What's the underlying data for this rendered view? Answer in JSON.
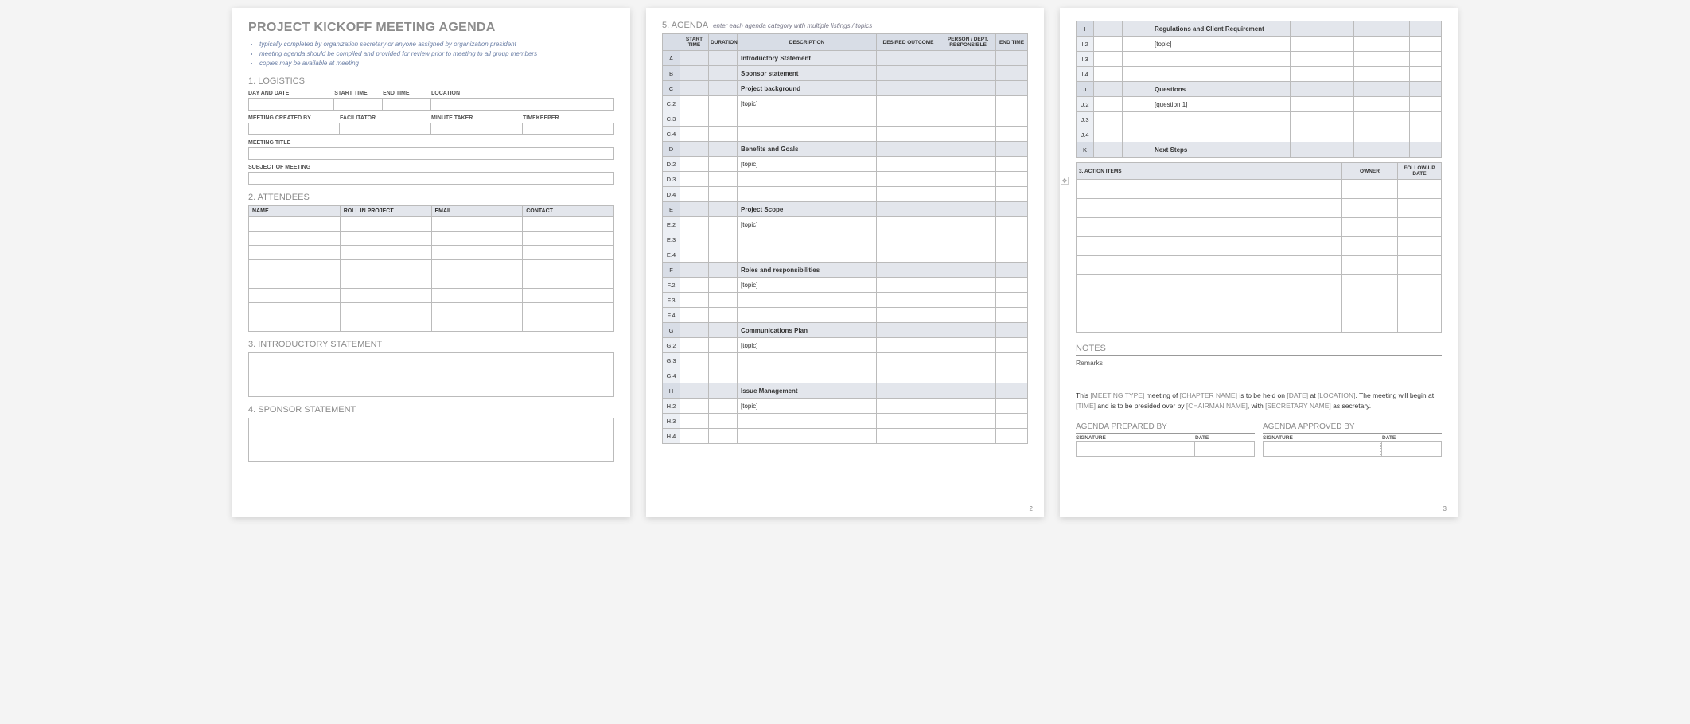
{
  "page1": {
    "title": "PROJECT KICKOFF MEETING AGENDA",
    "bullet1": "typically completed by organization secretary or anyone assigned by organization president",
    "bullet2": "meeting agenda should be compiled and provided for review prior to meeting to all group members",
    "bullet3": "copies may be available at meeting",
    "s1": "1. LOGISTICS",
    "f_day": "DAY AND DATE",
    "f_start": "START TIME",
    "f_end": "END TIME",
    "f_loc": "LOCATION",
    "f_created": "MEETING CREATED BY",
    "f_fac": "FACILITATOR",
    "f_min": "MINUTE TAKER",
    "f_time": "TIMEKEEPER",
    "f_title": "MEETING TITLE",
    "f_subj": "SUBJECT OF MEETING",
    "s2": "2. ATTENDEES",
    "att_h1": "NAME",
    "att_h2": "ROLL IN PROJECT",
    "att_h3": "EMAIL",
    "att_h4": "CONTACT",
    "s3": "3. INTRODUCTORY STATEMENT",
    "s4": "4. SPONSOR STATEMENT"
  },
  "page2": {
    "s5": "5. AGENDA",
    "note": "enter each agenda category with multiple listings / topics",
    "h1": "START TIME",
    "h2": "DURATION",
    "h3": "DESCRIPTION",
    "h4": "DESIRED OUTCOME",
    "h5": "PERSON / DEPT. RESPONSIBLE",
    "h6": "END TIME",
    "rows": [
      {
        "i": "A",
        "shade": true,
        "d": "Introductory Statement",
        "b": true
      },
      {
        "i": "B",
        "shade": true,
        "d": "Sponsor statement",
        "b": true
      },
      {
        "i": "C",
        "shade": true,
        "d": "Project background",
        "b": true
      },
      {
        "i": "C.2",
        "shade": false,
        "d": "[topic]"
      },
      {
        "i": "C.3",
        "shade": false,
        "d": ""
      },
      {
        "i": "C.4",
        "shade": false,
        "d": ""
      },
      {
        "i": "D",
        "shade": true,
        "d": "Benefits and Goals",
        "b": true
      },
      {
        "i": "D.2",
        "shade": false,
        "d": "[topic]"
      },
      {
        "i": "D.3",
        "shade": false,
        "d": ""
      },
      {
        "i": "D.4",
        "shade": false,
        "d": ""
      },
      {
        "i": "E",
        "shade": true,
        "d": "Project Scope",
        "b": true
      },
      {
        "i": "E.2",
        "shade": false,
        "d": "[topic]"
      },
      {
        "i": "E.3",
        "shade": false,
        "d": ""
      },
      {
        "i": "E.4",
        "shade": false,
        "d": ""
      },
      {
        "i": "F",
        "shade": true,
        "d": "Roles and responsibilities",
        "b": true
      },
      {
        "i": "F.2",
        "shade": false,
        "d": "[topic]"
      },
      {
        "i": "F.3",
        "shade": false,
        "d": ""
      },
      {
        "i": "F.4",
        "shade": false,
        "d": ""
      },
      {
        "i": "G",
        "shade": true,
        "d": "Communications Plan",
        "b": true
      },
      {
        "i": "G.2",
        "shade": false,
        "d": "[topic]"
      },
      {
        "i": "G.3",
        "shade": false,
        "d": ""
      },
      {
        "i": "G.4",
        "shade": false,
        "d": ""
      },
      {
        "i": "H",
        "shade": true,
        "d": "Issue Management",
        "b": true
      },
      {
        "i": "H.2",
        "shade": false,
        "d": "[topic]"
      },
      {
        "i": "H.3",
        "shade": false,
        "d": ""
      },
      {
        "i": "H.4",
        "shade": false,
        "d": ""
      }
    ],
    "pnum": "2"
  },
  "page3": {
    "rows": [
      {
        "i": "I",
        "shade": true,
        "d": "Regulations and Client Requirement",
        "b": true
      },
      {
        "i": "I.2",
        "shade": false,
        "d": "[topic]"
      },
      {
        "i": "I.3",
        "shade": false,
        "d": ""
      },
      {
        "i": "I.4",
        "shade": false,
        "d": ""
      },
      {
        "i": "J",
        "shade": true,
        "d": "Questions",
        "b": true
      },
      {
        "i": "J.2",
        "shade": false,
        "d": "[question 1]"
      },
      {
        "i": "J.3",
        "shade": false,
        "d": ""
      },
      {
        "i": "J.4",
        "shade": false,
        "d": ""
      },
      {
        "i": "K",
        "shade": true,
        "d": "Next Steps",
        "b": true
      }
    ],
    "action_title": "3. ACTION ITEMS",
    "ah1": "OWNER",
    "ah2": "FOLLOW-UP DATE",
    "notes": "NOTES",
    "remarks": "Remarks",
    "stmt_1": "This ",
    "stmt_2": "[MEETING TYPE]",
    "stmt_3": " meeting of ",
    "stmt_4": "[CHAPTER NAME]",
    "stmt_5": " is to be held on ",
    "stmt_6": "[DATE]",
    "stmt_7": " at ",
    "stmt_8": "[LOCATION]",
    "stmt_9": ".  The meeting will begin at ",
    "stmt_10": "[TIME]",
    "stmt_11": " and is to be presided over by ",
    "stmt_12": "[CHAIRMAN NAME]",
    "stmt_13": ", with ",
    "stmt_14": "[SECRETARY NAME]",
    "stmt_15": " as secretary.",
    "prep": "AGENDA PREPARED BY",
    "appr": "AGENDA APPROVED BY",
    "sig": "SIGNATURE",
    "date": "DATE",
    "pnum": "3"
  }
}
